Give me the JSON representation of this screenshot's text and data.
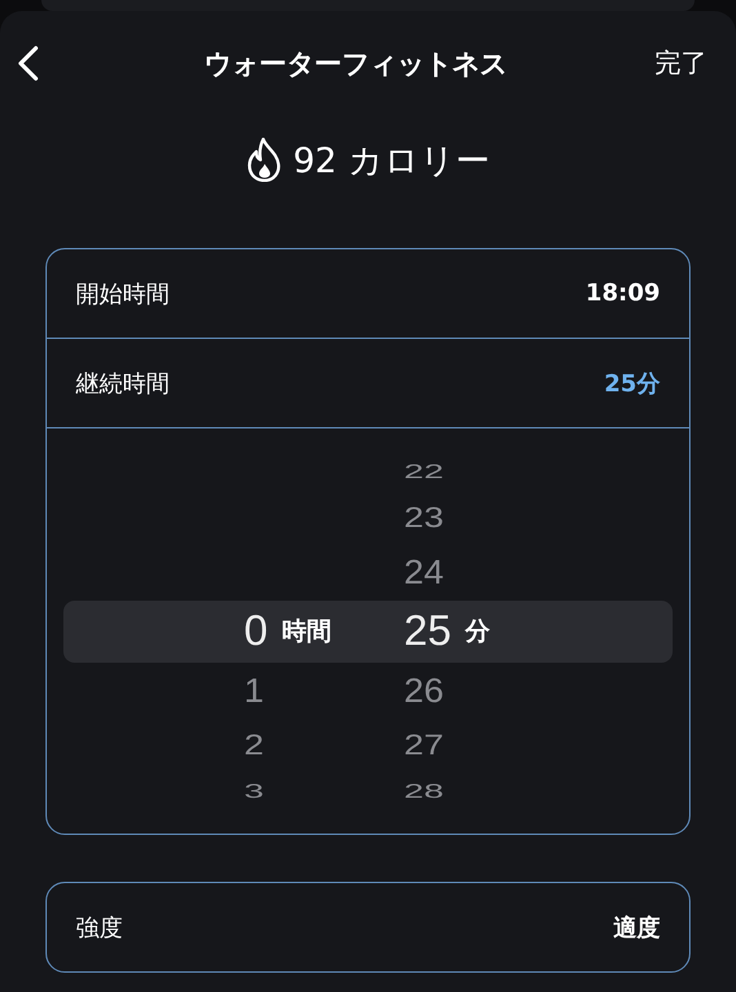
{
  "header": {
    "title": "ウォーターフィットネス",
    "done": "完了"
  },
  "calories": "92 カロリー",
  "rows": [
    {
      "label": "開始時間",
      "value": "18:09",
      "highlighted": false
    },
    {
      "label": "継続時間",
      "value": "25分",
      "highlighted": true
    }
  ],
  "picker": {
    "columns": [
      {
        "unit": "時間",
        "items": [
          {
            "label": "0",
            "selected": true
          },
          {
            "label": "1",
            "selected": false
          },
          {
            "label": "2",
            "selected": false
          },
          {
            "label": "3",
            "selected": false
          }
        ]
      },
      {
        "unit": "分",
        "items": [
          {
            "label": "22",
            "selected": false
          },
          {
            "label": "23",
            "selected": false
          },
          {
            "label": "24",
            "selected": false
          },
          {
            "label": "25",
            "selected": true
          },
          {
            "label": "26",
            "selected": false
          },
          {
            "label": "27",
            "selected": false
          },
          {
            "label": "28",
            "selected": false
          }
        ]
      }
    ]
  },
  "intensity": {
    "label": "強度",
    "value": "適度"
  }
}
